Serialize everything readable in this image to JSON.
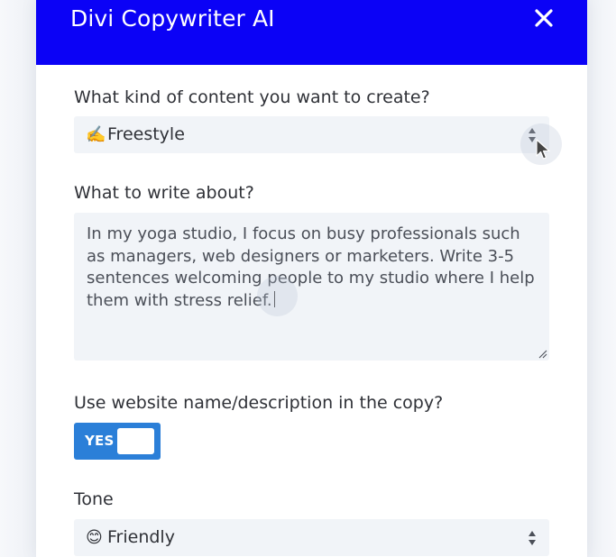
{
  "modal": {
    "title": "Divi Copywriter AI",
    "close_icon": "close-icon",
    "header_color": "#0b02f6"
  },
  "content_type": {
    "label": "What kind of content you want to create?",
    "emoji": "✍️",
    "selected": "Freestyle",
    "icon": "select-caret-icon"
  },
  "topic": {
    "label": "What to write about?",
    "value": "In my yoga studio, I focus on busy professionals such as managers, web designers or marketers. Write 3-5 sentences welcoming people to my studio where I help them with stress relief.",
    "resize_icon": "resize-handle-icon"
  },
  "website_copy": {
    "label": "Use website name/description in the copy?",
    "toggle_label": "YES",
    "enabled": true,
    "toggle_color": "#2b7fd8"
  },
  "tone": {
    "label": "Tone",
    "emoji": "😊",
    "selected": "Friendly",
    "icon": "select-caret-icon"
  }
}
